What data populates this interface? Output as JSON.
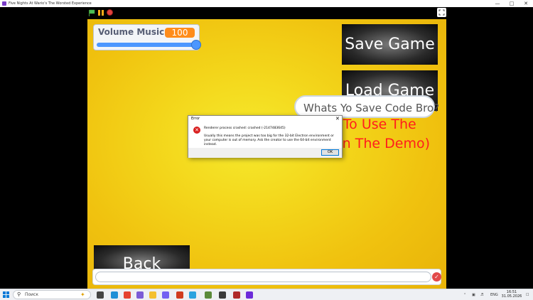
{
  "window": {
    "title": "Five Nights At Wario's The Worsted Experience"
  },
  "stage": {
    "monitor": {
      "label": "Volume Music",
      "value": "100",
      "slider_level": 1.0
    },
    "save_button": "Save Game",
    "load_button": "Load Game",
    "back_button": "Back",
    "speech_bubble": "Whats Yo Save Code Bro?",
    "red_line1": "ed To Use The",
    "red_line2": "n In The Demo)"
  },
  "dialog": {
    "title": "Error",
    "message1": "Renderer process crashed: crashed (-2147483645)",
    "message2": "Usually this means the project was too big for the 32-bit Electron environment or your computer is out of memory. Ask the creator to use the 64-bit environment instead.",
    "ok_label": "OK"
  },
  "taskbar": {
    "search_placeholder": "Поиск",
    "language": "ENG",
    "time": "16:51",
    "date": "31.05.2026"
  },
  "colors": {
    "stage_yellow": "#f3d51a",
    "monitor_value": "#ff8c1a",
    "slider": "#4c97ff",
    "red_text": "#ff1d1d"
  }
}
